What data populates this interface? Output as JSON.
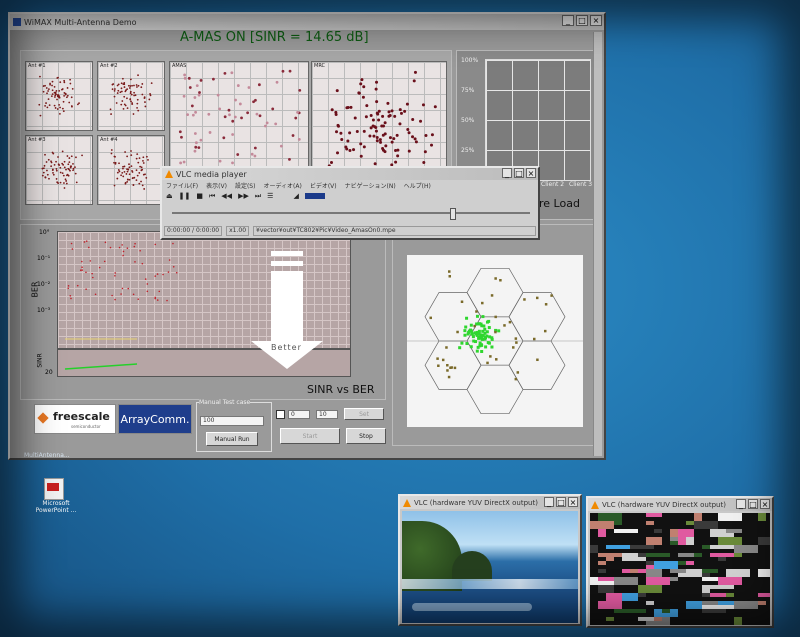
{
  "main_window": {
    "title": "WiMAX Multi-Antenna Demo",
    "headline": "A-MAS ON  [SINR = 14.65 dB]",
    "plots": {
      "ant1": "Ant #1",
      "ant2": "Ant #2",
      "ant3": "Ant #3",
      "ant4": "Ant #4",
      "amas": "AMAS",
      "mrc": "MRC"
    },
    "load_axis": [
      "100%",
      "75%",
      "50%",
      "25%"
    ],
    "load_clients": [
      "Client 2",
      "Client 3"
    ],
    "load_label": "re Load",
    "ber_chart": {
      "ylabel": "BER",
      "ytick_top": "10°",
      "ytick_2": "10⁻¹",
      "ytick_3": "10⁻²",
      "ytick_4": "10⁻³",
      "sinr_label": "SINR",
      "sinr_tick": "20",
      "arrow_text": "Better",
      "caption": "SINR vs BER"
    },
    "logos": {
      "freescale": "freescale",
      "freescale_sub": "semiconductor",
      "arraycomm": "ArrayComm."
    },
    "manual": {
      "group_label": "Manual Test case",
      "field_value": "100",
      "run_button": "Manual Run",
      "field2": "0",
      "field3": "0",
      "field4": "10",
      "btn_top": "Set",
      "start_button": "Start",
      "stop_button": "Stop"
    }
  },
  "vlc_player": {
    "title": "VLC media player",
    "menu": [
      "ファイル(F)",
      "表示(V)",
      "設定(S)",
      "オーディオ(A)",
      "ビデオ(V)",
      "ナビゲーション(N)",
      "ヘルプ(H)"
    ],
    "status_time": "0:00:00 / 0:00:00",
    "status_speed": "x1.00",
    "status_file": "¥vector¥out¥TC802¥Pic¥Video_AmasOn0.mpe"
  },
  "taskbar": {
    "label": "MultiAntenna..."
  },
  "desktop_icon": {
    "label": "Microsoft PowerPoint ..."
  },
  "vlc_output1": {
    "title": "VLC (hardware YUV DirectX output)"
  },
  "vlc_output2": {
    "title": "VLC (hardware YUV DirectX output)"
  }
}
